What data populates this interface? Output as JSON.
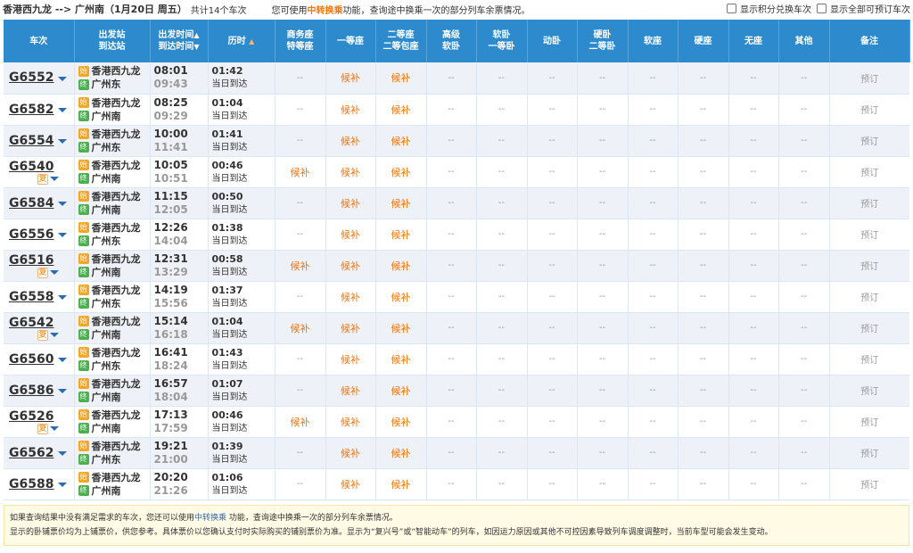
{
  "topbar": {
    "route": "香港西九龙 --> 广州南（1月20日  周五）",
    "count": "共计14个车次",
    "tip_prefix": "您可使用",
    "tip_link": "中转换乘",
    "tip_suffix": "功能，查询途中换乘一次的部分列车余票情况。",
    "opt_points": "显示积分兑换车次",
    "opt_all": "显示全部可预订车次"
  },
  "headers": {
    "train": "车次",
    "stations_1": "出发站",
    "stations_2": "到达站",
    "time_1": "出发时间",
    "time_2": "到达时间",
    "duration": "历时",
    "business_1": "商务座",
    "business_2": "特等座",
    "first": "一等座",
    "second_1": "二等座",
    "second_2": "二等包座",
    "adv_1": "高级",
    "adv_2": "软卧",
    "soft_1": "软卧",
    "soft_2": "一等卧",
    "dongwo": "动卧",
    "hard_1": "硬卧",
    "hard_2": "二等卧",
    "softseat": "软座",
    "hardseat": "硬座",
    "noseat": "无座",
    "other": "其他",
    "remark": "备注"
  },
  "labels": {
    "start_badge": "始",
    "end_badge": "终",
    "fx_badge": "复",
    "sameday": "当日到达",
    "na": "--",
    "houbu": "候补",
    "book": "预订"
  },
  "trains": [
    {
      "no": "G6552",
      "fx": false,
      "from": "香港西九龙",
      "to": "广州东",
      "dep": "08:01",
      "arr": "09:43",
      "dur": "01:42",
      "biz": "--",
      "first": "候补",
      "second": "候补"
    },
    {
      "no": "G6582",
      "fx": false,
      "from": "香港西九龙",
      "to": "广州南",
      "dep": "08:25",
      "arr": "09:29",
      "dur": "01:04",
      "biz": "--",
      "first": "候补",
      "second": "候补"
    },
    {
      "no": "G6554",
      "fx": false,
      "from": "香港西九龙",
      "to": "广州东",
      "dep": "10:00",
      "arr": "11:41",
      "dur": "01:41",
      "biz": "--",
      "first": "候补",
      "second": "候补"
    },
    {
      "no": "G6540",
      "fx": true,
      "from": "香港西九龙",
      "to": "广州南",
      "dep": "10:05",
      "arr": "10:51",
      "dur": "00:46",
      "biz": "候补",
      "first": "候补",
      "second": "候补"
    },
    {
      "no": "G6584",
      "fx": false,
      "from": "香港西九龙",
      "to": "广州南",
      "dep": "11:15",
      "arr": "12:05",
      "dur": "00:50",
      "biz": "--",
      "first": "候补",
      "second": "候补"
    },
    {
      "no": "G6556",
      "fx": false,
      "from": "香港西九龙",
      "to": "广州东",
      "dep": "12:26",
      "arr": "14:04",
      "dur": "01:38",
      "biz": "--",
      "first": "候补",
      "second": "候补"
    },
    {
      "no": "G6516",
      "fx": true,
      "from": "香港西九龙",
      "to": "广州南",
      "dep": "12:31",
      "arr": "13:29",
      "dur": "00:58",
      "biz": "候补",
      "first": "候补",
      "second": "候补"
    },
    {
      "no": "G6558",
      "fx": false,
      "from": "香港西九龙",
      "to": "广州东",
      "dep": "14:19",
      "arr": "15:56",
      "dur": "01:37",
      "biz": "--",
      "first": "候补",
      "second": "候补"
    },
    {
      "no": "G6542",
      "fx": true,
      "from": "香港西九龙",
      "to": "广州南",
      "dep": "15:14",
      "arr": "16:18",
      "dur": "01:04",
      "biz": "候补",
      "first": "候补",
      "second": "候补"
    },
    {
      "no": "G6560",
      "fx": false,
      "from": "香港西九龙",
      "to": "广州东",
      "dep": "16:41",
      "arr": "18:24",
      "dur": "01:43",
      "biz": "--",
      "first": "候补",
      "second": "候补"
    },
    {
      "no": "G6586",
      "fx": false,
      "from": "香港西九龙",
      "to": "广州南",
      "dep": "16:57",
      "arr": "18:04",
      "dur": "01:07",
      "biz": "--",
      "first": "候补",
      "second": "候补"
    },
    {
      "no": "G6526",
      "fx": true,
      "from": "香港西九龙",
      "to": "广州南",
      "dep": "17:13",
      "arr": "17:59",
      "dur": "00:46",
      "biz": "候补",
      "first": "候补",
      "second": "候补"
    },
    {
      "no": "G6562",
      "fx": false,
      "from": "香港西九龙",
      "to": "广州东",
      "dep": "19:21",
      "arr": "21:00",
      "dur": "01:39",
      "biz": "--",
      "first": "候补",
      "second": "候补"
    },
    {
      "no": "G6588",
      "fx": false,
      "from": "香港西九龙",
      "to": "广州南",
      "dep": "20:20",
      "arr": "21:26",
      "dur": "01:06",
      "biz": "--",
      "first": "候补",
      "second": "候补"
    }
  ],
  "notice": {
    "line1_prefix": "如果查询结果中没有满足需求的车次，您还可以使用",
    "line1_link": "中转换乘",
    "line1_suffix": " 功能，查询途中换乘一次的部分列车余票情况。",
    "line2": "显示的卧铺票价均为上铺票价，供您参考。具体票价以您确认支付时实际购买的铺别票价为准。显示为“复兴号”或“智能动车”的列车，如因运力原因或其他不可控因素导致列车调度调整时，当前车型可能会发生变动。"
  }
}
